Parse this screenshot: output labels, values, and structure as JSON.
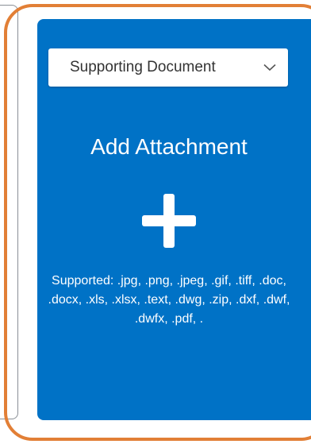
{
  "attachment_panel": {
    "document_type_select": {
      "selected": "Supporting Document",
      "chevron_icon": "chevron-down-icon"
    },
    "title": "Add Attachment",
    "add_icon": "plus-icon",
    "supported_formats": "Supported: .jpg, .png, .jpeg, .gif, .tiff, .doc, .docx, .xls, .xlsx, .text, .dwg, .zip, .dxf, .dwf, .dwfx, .pdf, ."
  },
  "colors": {
    "panel_background": "#0072c6",
    "highlight_outline": "#e27f36",
    "select_background": "#ffffff"
  }
}
